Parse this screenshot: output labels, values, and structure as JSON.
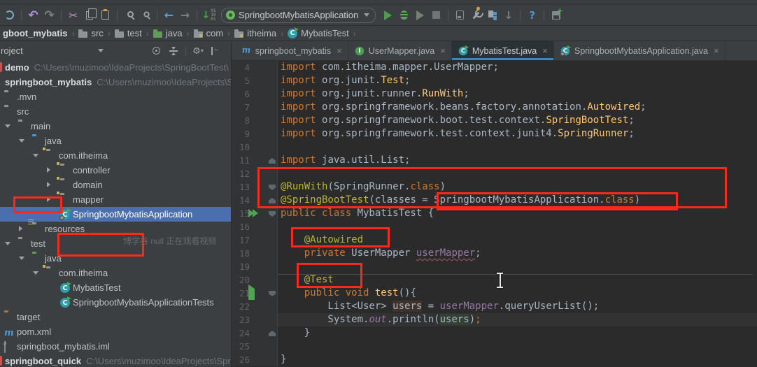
{
  "colors": {
    "selection": "#4B6EAF",
    "annotation_red": "#F92A1C",
    "tab_underline": "#3E86C0",
    "editor_bg": "#2B2B2B",
    "keyword": "#CC7832",
    "annotation": "#BBB529",
    "field": "#9876AA"
  },
  "toolbar": {
    "run_config": "SpringbootMybatisApplication",
    "icons": [
      "sync",
      "undo",
      "redo",
      "cut",
      "copy",
      "paste",
      "search",
      "replace",
      "back",
      "forward",
      "sort-lines",
      "run",
      "debug",
      "run-with-coverage",
      "stop",
      "profiler",
      "settings-wrench",
      "services",
      "deploy",
      "help",
      "save-all"
    ],
    "combo_caret_icon": "chevron-down-icon"
  },
  "breadcrumb": {
    "items": [
      {
        "label": "gboot_mybatis",
        "icon": null,
        "bold": true
      },
      {
        "label": "src",
        "icon": "folder"
      },
      {
        "label": "test",
        "icon": "folder"
      },
      {
        "label": "java",
        "icon": "folder-green"
      },
      {
        "label": "com",
        "icon": "package"
      },
      {
        "label": "itheima",
        "icon": "package"
      },
      {
        "label": "MybatisTest",
        "icon": "class"
      }
    ]
  },
  "project_panel": {
    "title": "roject",
    "header_icons": [
      "locate",
      "collapse-all",
      "settings",
      "hide"
    ],
    "watermark": "博学谷 null 正在观看视频",
    "tree": [
      {
        "label": "demo",
        "path": "C:\\Users\\muzimoo\\IdeaProjects\\SpringBootTest\\",
        "bold": true,
        "project": true,
        "sliver": true
      },
      {
        "label": "springboot_mybatis",
        "path": "C:\\Users\\muzimoo\\IdeaProjects\\S",
        "bold": true,
        "project": true
      },
      {
        "label": ".mvn",
        "depth": 0,
        "icon": "folder"
      },
      {
        "label": "src",
        "depth": 0,
        "icon": "folder"
      },
      {
        "label": "main",
        "depth": 1,
        "arrow": "open",
        "icon": "folder"
      },
      {
        "label": "java",
        "depth": 2,
        "arrow": "open",
        "icon": "folder-blue"
      },
      {
        "label": "com.itheima",
        "depth": 3,
        "arrow": "open",
        "icon": "package"
      },
      {
        "label": "controller",
        "depth": 4,
        "arrow": "closed",
        "icon": "package"
      },
      {
        "label": "domain",
        "depth": 4,
        "arrow": "closed",
        "icon": "package"
      },
      {
        "label": "mapper",
        "depth": 4,
        "arrow": "closed",
        "icon": "package"
      },
      {
        "label": "SpringbootMybatisApplication",
        "depth": 4,
        "icon": "class-sb",
        "selected": true
      },
      {
        "label": "resources",
        "depth": 2,
        "arrow": "closed",
        "icon": "folder-res"
      },
      {
        "label": "test",
        "depth": 1,
        "arrow": "open",
        "icon": "folder"
      },
      {
        "label": "java",
        "depth": 2,
        "arrow": "open",
        "icon": "folder-green"
      },
      {
        "label": "com.itheima",
        "depth": 3,
        "arrow": "open",
        "icon": "package"
      },
      {
        "label": "MybatisTest",
        "depth": 4,
        "icon": "class"
      },
      {
        "label": "SpringbootMybatisApplicationTests",
        "depth": 4,
        "icon": "class"
      },
      {
        "label": "target",
        "depth": 0,
        "icon": "folder-orange"
      },
      {
        "label": "pom.xml",
        "depth": 0,
        "icon": "maven"
      },
      {
        "label": "springboot_mybatis.iml",
        "depth": 0,
        "icon": "iml"
      },
      {
        "label": "springboot_quick",
        "path": "C:\\Users\\muzimoo\\IdeaProjects\\Spri",
        "bold": true,
        "project": true,
        "sliver": true
      }
    ]
  },
  "tabs": {
    "active_index": 2,
    "items": [
      {
        "icon": "maven",
        "label": "springboot_mybatis"
      },
      {
        "icon": "interface",
        "label": "UserMapper.java"
      },
      {
        "icon": "class",
        "label": "MybatisTest.java"
      },
      {
        "icon": "class-sb",
        "label": "SpringbootMybatisApplication.java"
      }
    ],
    "close_glyph": "×"
  },
  "editor": {
    "lines": [
      {
        "n": 4,
        "t": [
          [
            "k",
            "import "
          ],
          [
            "d",
            "com.itheima.mapper.UserMapper;"
          ]
        ]
      },
      {
        "n": 5,
        "t": [
          [
            "k",
            "import "
          ],
          [
            "d",
            "org.junit."
          ],
          [
            "c",
            "Test"
          ],
          [
            "d",
            ";"
          ]
        ]
      },
      {
        "n": 6,
        "t": [
          [
            "k",
            "import "
          ],
          [
            "d",
            "org.junit.runner."
          ],
          [
            "c",
            "RunWith"
          ],
          [
            "d",
            ";"
          ]
        ]
      },
      {
        "n": 7,
        "t": [
          [
            "k",
            "import "
          ],
          [
            "d",
            "org.springframework.beans.factory.annotation."
          ],
          [
            "c",
            "Autowired"
          ],
          [
            "d",
            ";"
          ]
        ]
      },
      {
        "n": 8,
        "t": [
          [
            "k",
            "import "
          ],
          [
            "d",
            "org.springframework.boot.test.context."
          ],
          [
            "c",
            "SpringBootTest"
          ],
          [
            "d",
            ";"
          ]
        ]
      },
      {
        "n": 9,
        "t": [
          [
            "k",
            "import "
          ],
          [
            "d",
            "org.springframework.test.context.junit4."
          ],
          [
            "c",
            "SpringRunner"
          ],
          [
            "d",
            ";"
          ]
        ]
      },
      {
        "n": 10,
        "t": []
      },
      {
        "n": 11,
        "t": [
          [
            "k",
            "import "
          ],
          [
            "d",
            "java.util.List;"
          ]
        ],
        "fold": "up"
      },
      {
        "n": 12,
        "t": []
      },
      {
        "n": 13,
        "t": [
          [
            "a",
            "@RunWith"
          ],
          [
            "d",
            "(SpringRunner."
          ],
          [
            "k",
            "class"
          ],
          [
            "d",
            ")"
          ]
        ],
        "fold": "down"
      },
      {
        "n": 14,
        "t": [
          [
            "a",
            "@SpringBootTest"
          ],
          [
            "d",
            "(classes = SpringbootMybatisApplication."
          ],
          [
            "k",
            "class"
          ],
          [
            "d",
            ")"
          ]
        ],
        "g": "leaf",
        "fold": "up"
      },
      {
        "n": 15,
        "t": [
          [
            "k",
            "public class "
          ],
          [
            "d",
            "MybatisTest {"
          ]
        ],
        "g": "run2",
        "fold": "down"
      },
      {
        "n": 16,
        "t": []
      },
      {
        "n": 17,
        "t": [
          [
            "d",
            "    "
          ],
          [
            "a",
            "@Autowired"
          ]
        ]
      },
      {
        "n": 18,
        "t": [
          [
            "d",
            "    "
          ],
          [
            "k",
            "private "
          ],
          [
            "d",
            "UserMapper "
          ],
          [
            "uw",
            "userMapper"
          ],
          [
            "d",
            ";"
          ]
        ]
      },
      {
        "n": 19,
        "t": []
      },
      {
        "n": 20,
        "t": [
          [
            "d",
            "    "
          ],
          [
            "a",
            "@Test"
          ]
        ],
        "sep": true
      },
      {
        "n": 21,
        "t": [
          [
            "d",
            "    "
          ],
          [
            "k",
            "public void "
          ],
          [
            "m",
            "test"
          ],
          [
            "d",
            "(){"
          ]
        ],
        "g": "run",
        "fold": "down"
      },
      {
        "n": 22,
        "t": [
          [
            "d",
            "        List<User> "
          ],
          [
            "wu",
            "users"
          ],
          [
            "d",
            " = "
          ],
          [
            "f",
            "userMapper"
          ],
          [
            "d",
            ".queryUserList();"
          ]
        ]
      },
      {
        "n": 23,
        "t": [
          [
            "d",
            "        System."
          ],
          [
            "fi",
            "out"
          ],
          [
            "d",
            ".println("
          ],
          [
            "ru",
            "users"
          ],
          [
            "d",
            ")"
          ],
          [
            "k",
            ";"
          ]
        ],
        "cur": true
      },
      {
        "n": 24,
        "t": [
          [
            "d",
            "    }"
          ]
        ],
        "fold": "up"
      },
      {
        "n": 25,
        "t": []
      },
      {
        "n": 26,
        "t": [
          [
            "d",
            "}"
          ]
        ]
      }
    ]
  }
}
